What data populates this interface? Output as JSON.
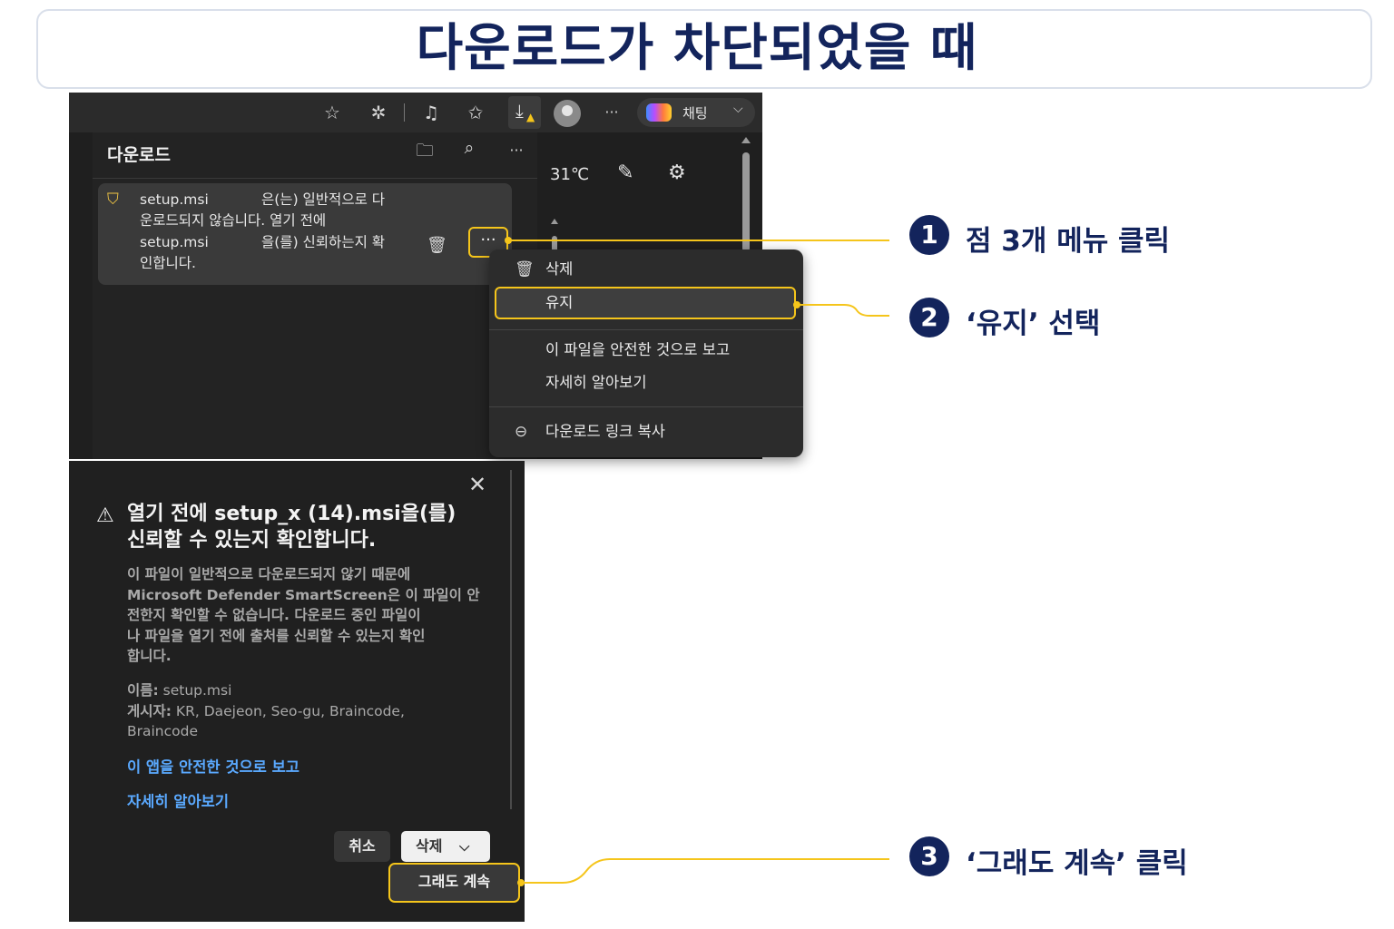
{
  "title": "다운로드가 차단되었을 때",
  "browser": {
    "chat_label": "채팅",
    "more_glyph": "···",
    "weather": "31℃"
  },
  "downloads": {
    "title": "다운로드",
    "item": {
      "line1_file": "setup.msi",
      "line1_rest": "은(는) 일반적으로 다",
      "line2": "운로드되지 않습니다. 열기 전에",
      "line3_file": "setup.msi",
      "line3_rest": "을(를) 신뢰하는지 확",
      "line4": "인합니다.",
      "more_glyph": "···"
    }
  },
  "context_menu": {
    "delete": "삭제",
    "keep": "유지",
    "report_safe": "이 파일을 안전한 것으로 보고",
    "learn_more": "자세히 알아보기",
    "copy_link": "다운로드 링크 복사"
  },
  "dialog": {
    "heading_line1": "열기 전에 setup_x (14).msi을(를)",
    "heading_line2": "신뢰할 수 있는지 확인합니다.",
    "body": [
      "이 파일이 일반적으로 다운로드되지 않기 때문에",
      "Microsoft Defender SmartScreen은 이 파일이 안",
      "전한지 확인할 수 없습니다. 다운로드 중인 파일이",
      "나 파일을 열기 전에 출처를 신뢰할 수 있는지 확인",
      "합니다."
    ],
    "name_label": "이름:",
    "name_value": "setup.msi",
    "publisher_label": "게시자:",
    "publisher_value": "KR, Daejeon, Seo-gu, Braincode,",
    "publisher_value2": "Braincode",
    "link_report": "이 앱을 안전한 것으로 보고",
    "link_learn": "자세히 알아보기",
    "btn_cancel": "취소",
    "btn_delete": "삭제",
    "btn_continue": "그래도 계속"
  },
  "annotations": [
    {
      "num": "1",
      "text": "점 3개 메뉴 클릭"
    },
    {
      "num": "2",
      "text": "‘유지’ 선택"
    },
    {
      "num": "3",
      "text": "‘그래도 계속’ 클릭"
    }
  ],
  "colors": {
    "accent": "#f5c51b",
    "navy": "#13245c",
    "link": "#5aa9ff"
  }
}
